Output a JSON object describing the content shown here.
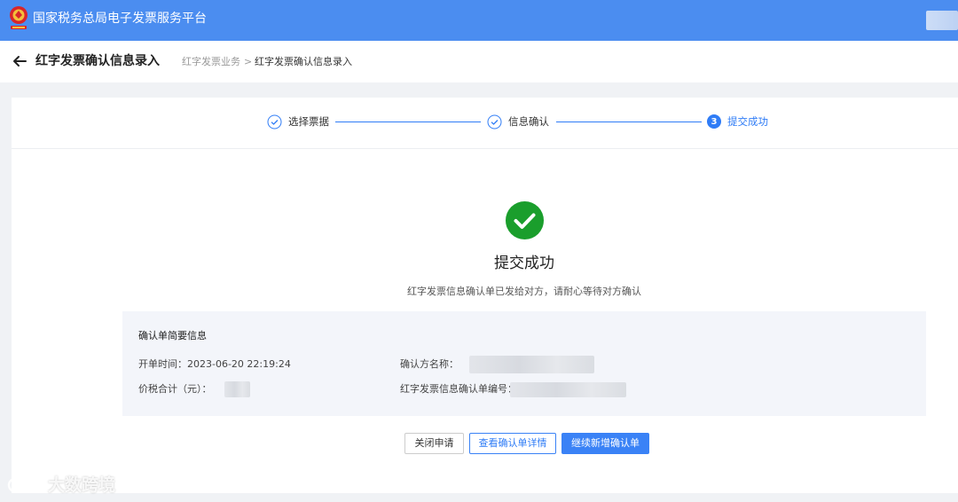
{
  "app": {
    "title": "国家税务总局电子发票服务平台"
  },
  "header": {
    "title": "红字发票确认信息录入",
    "breadcrumb": [
      "红字发票业务",
      "红字发票确认信息录入"
    ],
    "breadcrumb_separator": ">"
  },
  "steps": [
    {
      "label": "选择票据",
      "state": "done",
      "icon": "check-circle-icon"
    },
    {
      "label": "信息确认",
      "state": "done",
      "icon": "check-circle-icon"
    },
    {
      "label": "提交成功",
      "state": "active",
      "number": "3"
    }
  ],
  "result": {
    "title": "提交成功",
    "message": "红字发票信息确认单已发给对方，请耐心等待对方确认",
    "icon": "success-check-icon"
  },
  "summary": {
    "title": "确认单简要信息",
    "fields": [
      {
        "label": "开单时间：",
        "value": "2023-06-20 22:19:24"
      },
      {
        "label": "价税合计（元）：",
        "value": ""
      },
      {
        "label": "确认方名称：",
        "value": ""
      },
      {
        "label": "红字发票信息确认单编号：",
        "value": ""
      }
    ]
  },
  "buttons": {
    "close": "关闭申请",
    "view_detail": "查看确认单详情",
    "continue_add": "继续新增确认单"
  },
  "watermark": {
    "text": "大数跨境"
  },
  "colors": {
    "topbar": "#4b8df0",
    "accent": "#2f7cf6",
    "success": "#1a9e2c"
  }
}
